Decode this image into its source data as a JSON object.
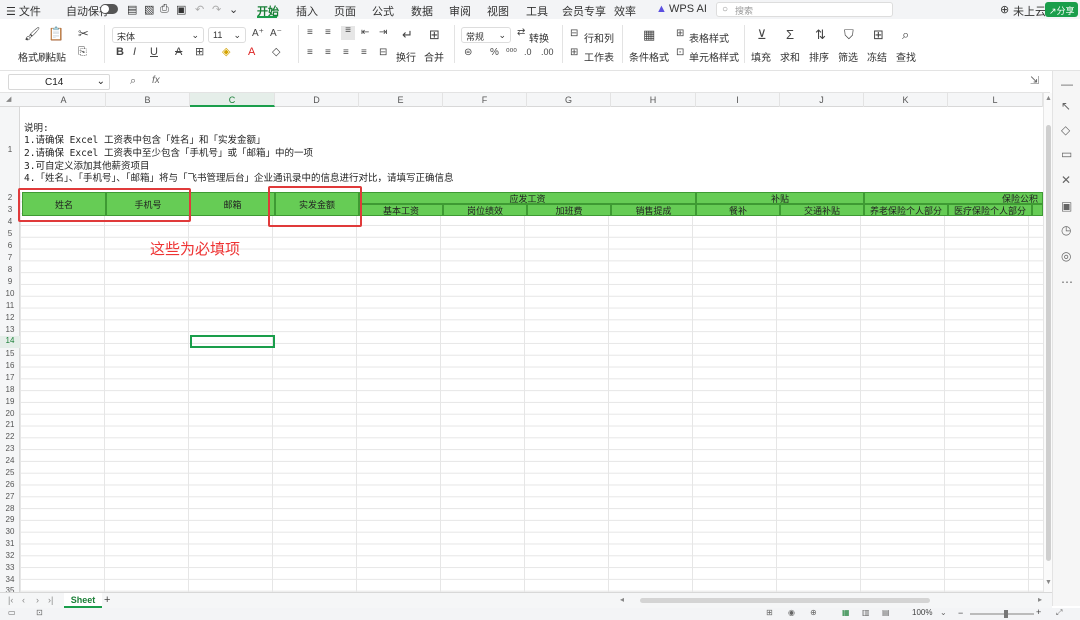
{
  "menubar": {
    "file": "文件",
    "autosave": "自动保存",
    "tabs": [
      "开始",
      "插入",
      "页面",
      "公式",
      "数据",
      "审阅",
      "视图",
      "工具",
      "会员专享",
      "效率"
    ],
    "wps_ai": "WPS AI",
    "search_placeholder": "搜索",
    "cloud": "未上云",
    "share": "分享"
  },
  "ribbon": {
    "format_painter": "格式刷",
    "paste": "粘贴",
    "font_name": "宋体",
    "font_size": "11",
    "wrap": "换行",
    "merge": "合并",
    "number_format": "常规",
    "convert": "转换",
    "row_col": "行和列",
    "worksheet": "工作表",
    "cond_format": "条件格式",
    "table_style": "表格样式",
    "cell_style": "单元格样式",
    "fill": "填充",
    "sum": "求和",
    "sort": "排序",
    "filter": "筛选",
    "freeze": "冻结",
    "find": "查找"
  },
  "formula": {
    "cell_ref": "C14",
    "fx": "fx",
    "value": ""
  },
  "columns": [
    "A",
    "B",
    "C",
    "D",
    "E",
    "F",
    "G",
    "H",
    "I",
    "J",
    "K",
    "L"
  ],
  "selected_column": "C",
  "selected_row": 14,
  "rows": [
    "1",
    "2",
    "3",
    "4",
    "5",
    "6",
    "7",
    "8",
    "9",
    "10",
    "11",
    "12",
    "13",
    "14",
    "15",
    "16",
    "17",
    "18",
    "19",
    "20",
    "21",
    "22",
    "23",
    "24",
    "25",
    "26",
    "27",
    "28",
    "29",
    "30",
    "31",
    "32",
    "33",
    "34",
    "35"
  ],
  "notes": [
    "说明:",
    "1.请确保 Excel 工资表中包含「姓名」和「实发金额」",
    "2.请确保 Excel 工资表中至少包含「手机号」或「邮箱」中的一项",
    "3.可自定义添加其他薪资项目",
    "4.「姓名」、「手机号」、「邮箱」将与「飞书管理后台」企业通讯录中的信息进行对比，请填写正确信息"
  ],
  "headers": {
    "name": "姓名",
    "phone": "手机号",
    "email": "邮箱",
    "net_pay": "实发金额",
    "gross_pay": "应发工资",
    "allowance": "补贴",
    "insurance": "保险公积",
    "base_salary": "基本工资",
    "post_perf": "岗位绩效",
    "overtime": "加班费",
    "sales_comm": "销售提成",
    "meal": "餐补",
    "transport": "交通补贴",
    "pension": "养老保险个人部分",
    "medical": "医疗保险个人部分"
  },
  "annotation": "这些为必填项",
  "sheet_tab": "Sheet",
  "zoom": "100%",
  "colors": {
    "accent": "#1a9e4b",
    "header_green": "#66cc55",
    "annotation_red": "#e03a3a"
  }
}
